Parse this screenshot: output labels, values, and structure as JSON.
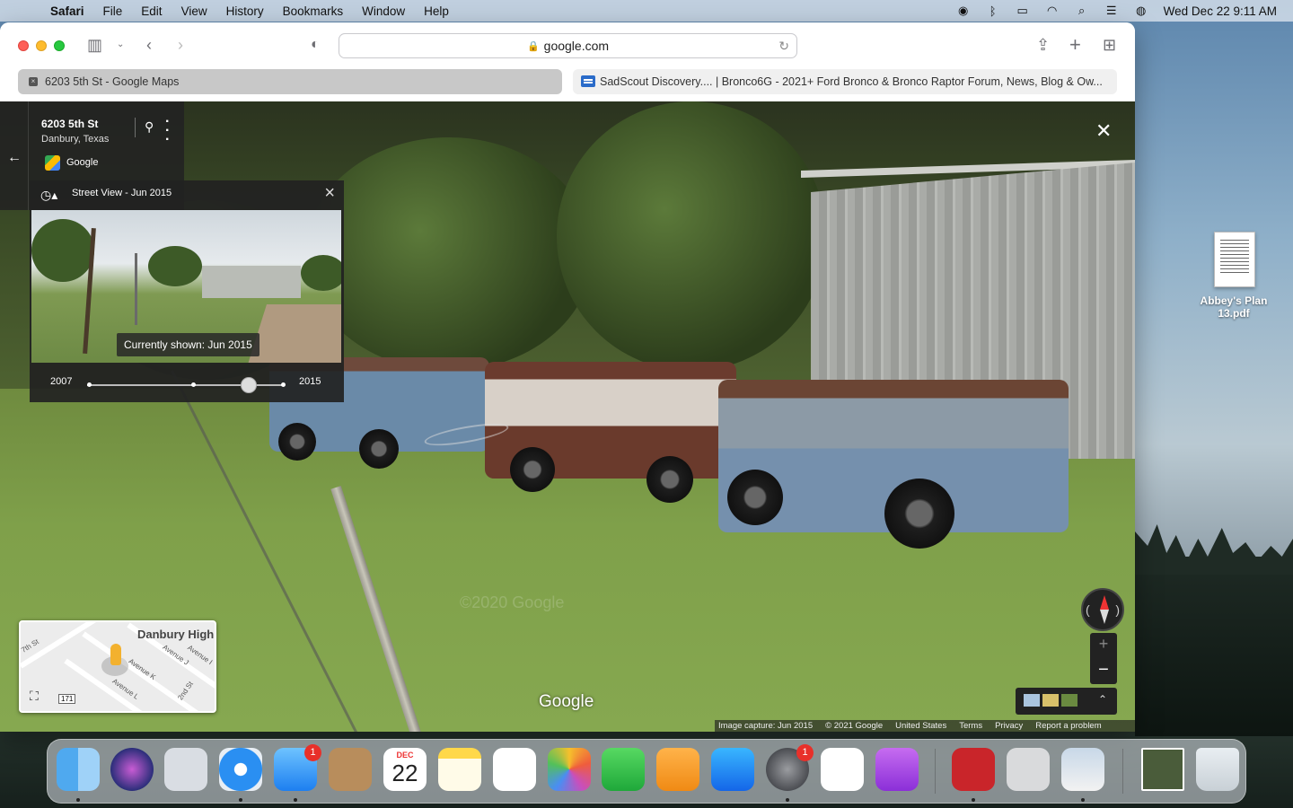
{
  "menubar": {
    "app": "Safari",
    "items": [
      "File",
      "Edit",
      "View",
      "History",
      "Bookmarks",
      "Window",
      "Help"
    ],
    "clock": "Wed Dec 22  9:11 AM"
  },
  "browser": {
    "url": "google.com",
    "tabs": [
      {
        "label": "6203 5th St - Google Maps",
        "active": true
      },
      {
        "label": "SadScout Discovery.... | Bronco6G - 2021+ Ford Bronco & Bronco Raptor Forum, News, Blog & Ow...",
        "active": false
      }
    ]
  },
  "streetview": {
    "address": "6203 5th St",
    "locality": "Danbury, Texas",
    "provider": "Google",
    "time_label": "Street View - Jun 2015",
    "caption": "Currently shown: Jun 2015",
    "year_start": "2007",
    "year_end": "2015",
    "slider_value": 0.82,
    "watermark": "©2020 Google",
    "logo": "Google",
    "attribution": [
      "Image capture: Jun 2015",
      "© 2021 Google",
      "United States",
      "Terms",
      "Privacy",
      "Report a problem"
    ]
  },
  "minimap": {
    "place": "Danbury High",
    "streets": [
      "Avenue J",
      "Avenue I",
      "Avenue K",
      "Avenue L",
      "2nd St",
      "7th St"
    ],
    "route": "171"
  },
  "desktop": {
    "file_label": "Abbey's Plan 13.pdf"
  },
  "dock": {
    "mail_badge": "1",
    "settings_badge": "1",
    "calendar_month": "DEC",
    "calendar_day": "22"
  },
  "colors": {
    "accent": "#2a6bc9",
    "badge": "#e8302a"
  }
}
